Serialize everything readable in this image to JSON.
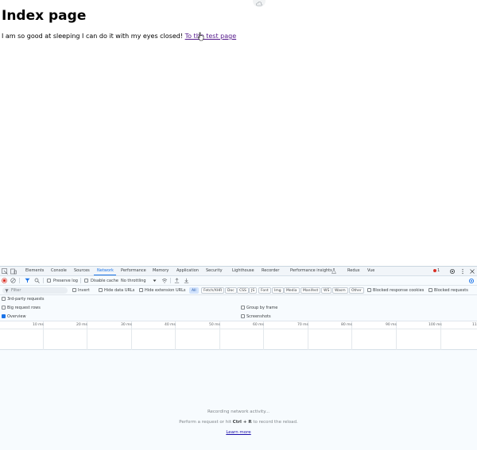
{
  "page": {
    "heading": "Index page",
    "text": "I am so good at sleeping I can do it with my eyes closed!",
    "link_text": "To the test page"
  },
  "devtools": {
    "tabs": [
      "Elements",
      "Console",
      "Sources",
      "Network",
      "Performance",
      "Memory",
      "Application",
      "Security",
      "Lighthouse",
      "Recorder",
      "Performance insights",
      "Redux",
      "Vue"
    ],
    "active_tab": "Network",
    "error_count": "1",
    "toolbar": {
      "preserve_log": "Preserve log",
      "disable_cache": "Disable cache",
      "throttling": "No throttling"
    },
    "filter": {
      "placeholder": "Filter",
      "invert": "Invert",
      "hide_data_urls": "Hide data URLs",
      "hide_extension_urls": "Hide extension URLs",
      "chips": [
        "All",
        "Fetch/XHR",
        "Doc",
        "CSS",
        "JS",
        "Font",
        "Img",
        "Media",
        "Manifest",
        "WS",
        "Wasm",
        "Other"
      ],
      "active_chip": "All",
      "blocked_response_cookies": "Blocked response cookies",
      "blocked_requests": "Blocked requests"
    },
    "options": {
      "third_party": "3rd-party requests",
      "big_request_rows": "Big request rows",
      "group_by_frame": "Group by frame",
      "overview": "Overview",
      "screenshots": "Screenshots"
    },
    "timeline_ticks": [
      "10 ms",
      "20 ms",
      "30 ms",
      "40 ms",
      "50 ms",
      "60 ms",
      "70 ms",
      "80 ms",
      "90 ms",
      "100 ms",
      "11"
    ],
    "empty_state": {
      "line1": "Recording network activity...",
      "line2_pre": "Perform a request or hit",
      "line2_key": "Ctrl + R",
      "line2_post": "to record the reload.",
      "learn_more": "Learn more"
    },
    "colors": {
      "accent": "#1a73e8",
      "record": "#d93025"
    }
  }
}
